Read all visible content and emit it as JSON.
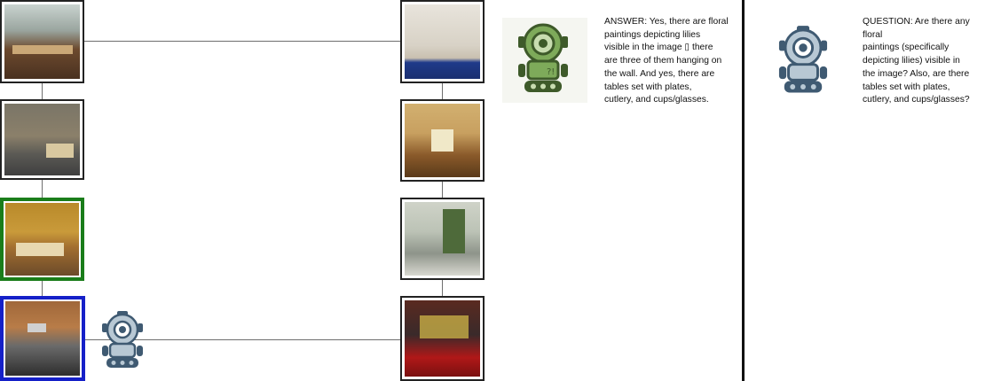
{
  "answer": {
    "text": "ANSWER: Yes, there are floral\npaintings depicting lilies\nvisible in the image ▯ there\nare three of them hanging on\nthe wall. And yes, there are\ntables set with plates,\ncutlery, and cups/glasses."
  },
  "question": {
    "text": "QUESTION: Are there any floral\npaintings (specifically\ndepicting lilies) visible in\nthe image? Also, are there\ntables set with plates,\ncutlery, and cups/glasses?"
  },
  "left_column": [
    {
      "scene": "dining-room-windows",
      "selection": "none"
    },
    {
      "scene": "waiting-room",
      "selection": "none"
    },
    {
      "scene": "restaurant-floral-paintings",
      "selection": "green"
    },
    {
      "scene": "kitchen",
      "selection": "blue"
    }
  ],
  "right_column": [
    {
      "scene": "attic-room"
    },
    {
      "scene": "formal-dining-room"
    },
    {
      "scene": "room-with-french-doors"
    },
    {
      "scene": "arcade-machines"
    }
  ],
  "colors": {
    "green_highlight": "#1a7d1a",
    "blue_highlight": "#1520c8",
    "answer_robot": "#6f9a4e",
    "question_robot": "#3f5a72"
  },
  "icons": {
    "answer_agent": "green-robot-icon",
    "question_agent": "blue-robot-icon",
    "current_agent": "blue-robot-icon"
  }
}
